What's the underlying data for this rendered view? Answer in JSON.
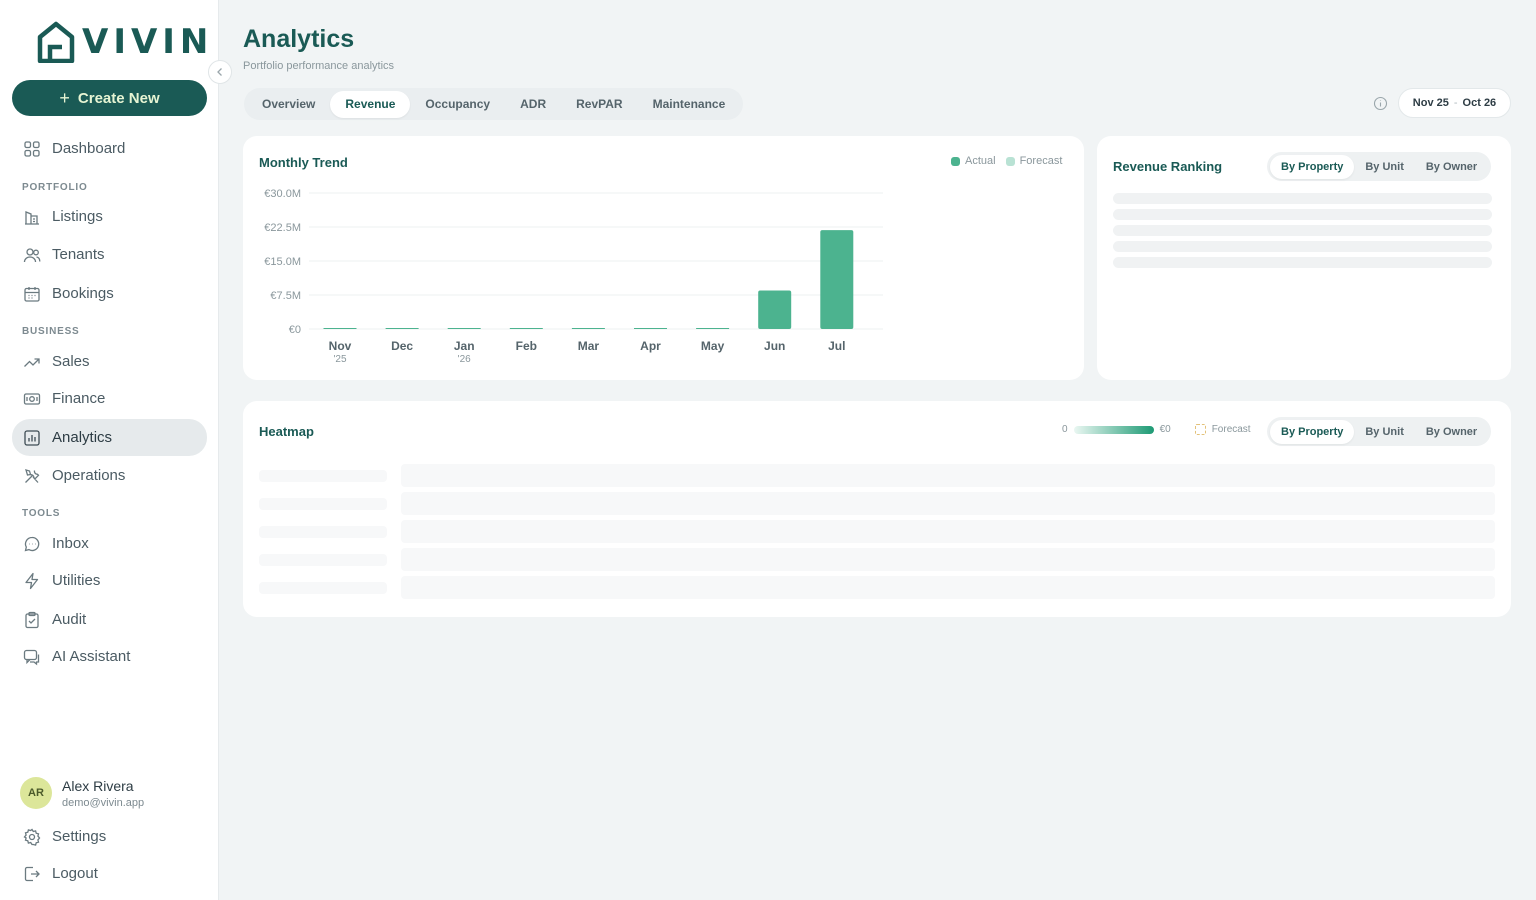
{
  "app": {
    "logo_text": "VIVIN"
  },
  "sidebar": {
    "create_label": "Create New",
    "dashboard": "Dashboard",
    "sections": {
      "portfolio": "PORTFOLIO",
      "business": "BUSINESS",
      "tools": "TOOLS"
    },
    "items": {
      "listings": "Listings",
      "tenants": "Tenants",
      "bookings": "Bookings",
      "sales": "Sales",
      "finance": "Finance",
      "analytics": "Analytics",
      "operations": "Operations",
      "inbox": "Inbox",
      "utilities": "Utilities",
      "audit": "Audit",
      "ai_assistant": "AI Assistant"
    },
    "active_item": "analytics",
    "user": {
      "initials": "AR",
      "name": "Alex Rivera",
      "email": "demo@vivin.app"
    },
    "settings": "Settings",
    "logout": "Logout"
  },
  "header": {
    "title": "Analytics",
    "subtitle": "Portfolio performance analytics",
    "tabs": [
      "Overview",
      "Revenue",
      "Occupancy",
      "ADR",
      "RevPAR",
      "Maintenance"
    ],
    "active_tab": "Revenue",
    "date_from": "Nov 25",
    "date_sep": "-",
    "date_to": "Oct 26"
  },
  "monthly_trend": {
    "title": "Monthly Trend",
    "legend": {
      "actual": "Actual",
      "forecast": "Forecast"
    }
  },
  "revenue_ranking": {
    "title": "Revenue Ranking",
    "toggle": [
      "By Property",
      "By Unit",
      "By Owner"
    ],
    "active": "By Property"
  },
  "heatmap": {
    "title": "Heatmap",
    "scale_min": "0",
    "scale_max": "€0",
    "forecast_label": "Forecast",
    "toggle": [
      "By Property",
      "By Unit",
      "By Owner"
    ],
    "active": "By Property"
  },
  "colors": {
    "brand": "#1a5a55",
    "actual": "#4cb38f",
    "forecast": "#b9e2d4",
    "accent_light": "#e6f4d3"
  },
  "chart_data": {
    "type": "bar",
    "title": "Monthly Trend",
    "categories": [
      "Nov",
      "Dec",
      "Jan",
      "Feb",
      "Mar",
      "Apr",
      "May",
      "Jun",
      "Jul"
    ],
    "category_sublabels": [
      "'25",
      "",
      "'26",
      "",
      "",
      "",
      "",
      "",
      ""
    ],
    "series": [
      {
        "name": "Actual",
        "values": [
          0,
          0,
          0.1,
          0.1,
          0.1,
          0.1,
          0.2,
          8.5,
          21.8
        ]
      }
    ],
    "units": "€M",
    "ylim": [
      0,
      30
    ],
    "yticks": [
      0,
      7.5,
      15,
      22.5,
      30
    ],
    "ytick_labels": [
      "€0",
      "€7.5M",
      "€15.0M",
      "€22.5M",
      "€30.0M"
    ],
    "grid": true,
    "legend": "top-right"
  }
}
